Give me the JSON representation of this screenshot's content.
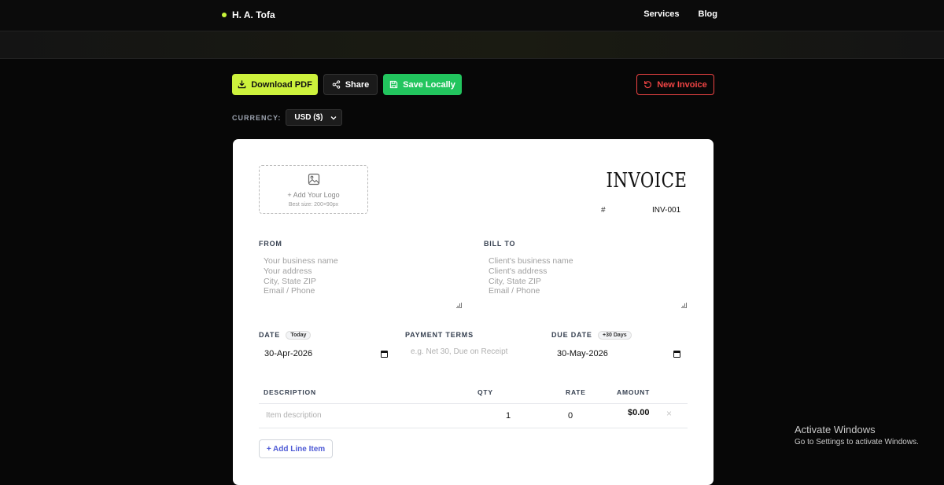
{
  "nav": {
    "brand": "H. A. Tofa",
    "links": [
      "Services",
      "Blog"
    ]
  },
  "toolbar": {
    "download_label": "Download PDF",
    "share_label": "Share",
    "save_label": "Save Locally",
    "new_label": "New Invoice"
  },
  "currency": {
    "label": "CURRENCY:",
    "value": "USD ($)"
  },
  "invoice": {
    "logo_text": "+ Add Your Logo",
    "logo_hint": "Best size: 200×90px",
    "title": "INVOICE",
    "number_label": "#",
    "number": "INV-001",
    "from": {
      "label": "FROM",
      "placeholder": [
        "Your business name",
        "Your address",
        "City, State ZIP",
        "Email / Phone"
      ]
    },
    "bill_to": {
      "label": "BILL TO",
      "placeholder": [
        "Client's business name",
        "Client's address",
        "City, State ZIP",
        "Email / Phone"
      ]
    },
    "date": {
      "label": "DATE",
      "pill": "Today",
      "value": "30-Apr-2026"
    },
    "payment_terms": {
      "label": "PAYMENT TERMS",
      "placeholder": "e.g. Net 30, Due on Receipt"
    },
    "due_date": {
      "label": "DUE DATE",
      "pill": "+30 Days",
      "value": "30-May-2026"
    },
    "table": {
      "headers": [
        "DESCRIPTION",
        "QTY",
        "RATE",
        "AMOUNT"
      ],
      "rows": [
        {
          "description_placeholder": "Item description",
          "qty": "1",
          "rate": "0",
          "amount": "$0.00"
        }
      ],
      "remove_symbol": "×"
    },
    "add_item_label": "+ Add Line Item"
  },
  "os_watermark": {
    "title": "Activate Windows",
    "subtitle": "Go to Settings to activate Windows."
  },
  "colors": {
    "accent": "#cdf23c",
    "save": "#22c55e",
    "danger": "#ef4444",
    "link": "#4f5bd5"
  }
}
